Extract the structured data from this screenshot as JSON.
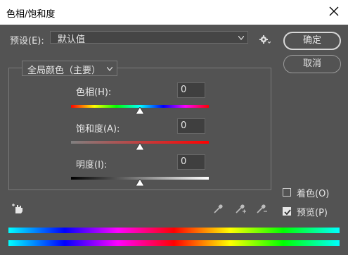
{
  "window": {
    "title": "色相/饱和度"
  },
  "preset": {
    "label": "预设(E):",
    "value": "默认值"
  },
  "buttons": {
    "ok": "确定",
    "cancel": "取消"
  },
  "channel": {
    "value": "全局颜色（主要）"
  },
  "sliders": [
    {
      "label": "色相(H):",
      "value": "0"
    },
    {
      "label": "饱和度(A):",
      "value": "0"
    },
    {
      "label": "明度(I):",
      "value": "0"
    }
  ],
  "options": {
    "colorize": {
      "label": "着色(O)",
      "checked": false
    },
    "preview": {
      "label": "预览(P)",
      "checked": true
    }
  },
  "icons": {
    "settings": "gear-icon",
    "targeted_adjustment": "hand-icon",
    "eyedroppers": [
      "eyedropper-icon",
      "eyedropper-plus-icon",
      "eyedropper-minus-icon"
    ]
  },
  "colors": {
    "dialog_bg": "#535353",
    "titlebar_bg": "#ffffff"
  }
}
